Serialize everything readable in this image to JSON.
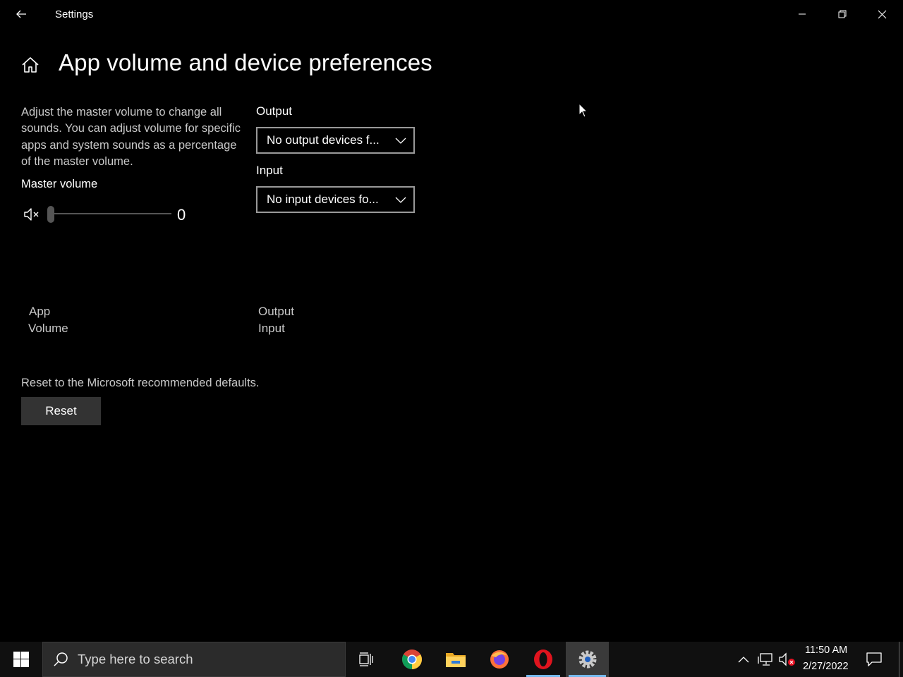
{
  "window": {
    "title": "Settings"
  },
  "header": {
    "title": "App volume and device preferences"
  },
  "master": {
    "description": "Adjust the master volume to change all sounds. You can adjust volume for specific apps and system sounds as a percentage of the master volume.",
    "label": "Master volume",
    "value": "0",
    "muted": true,
    "icon": "volume-mute-icon"
  },
  "devices": {
    "output_label": "Output",
    "output_selected": "No output devices f...",
    "input_label": "Input",
    "input_selected": "No input devices fo..."
  },
  "columns": {
    "app": "App",
    "volume": "Volume",
    "output": "Output",
    "input": "Input"
  },
  "reset": {
    "description": "Reset to the Microsoft recommended defaults.",
    "button": "Reset"
  },
  "taskbar": {
    "search_placeholder": "Type here to search",
    "apps": [
      "task-view-icon",
      "chrome-icon",
      "file-explorer-icon",
      "firefox-icon",
      "opera-icon",
      "settings-icon"
    ],
    "active_app": "settings-icon",
    "time": "11:50 AM",
    "date": "2/27/2022"
  },
  "colors": {
    "background": "#000000",
    "accent": "#76b9ed",
    "button": "#333333"
  }
}
